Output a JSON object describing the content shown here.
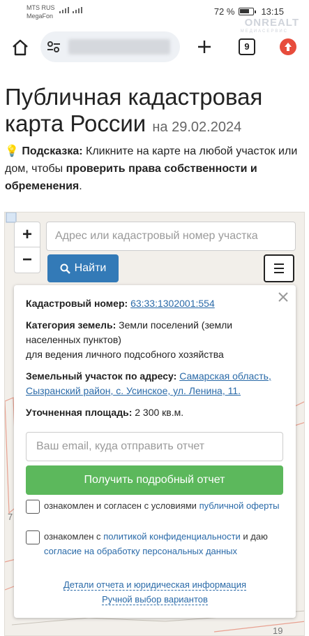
{
  "status_bar": {
    "carrier_1": "MTS RUS",
    "carrier_2": "MegaFon",
    "battery": "72 %",
    "time": "13:15",
    "watermark": "ONREALT",
    "watermark_sub": "МЕДИАСЕРВИС"
  },
  "browser": {
    "tabs_count": "9",
    "profile_color": "#e74c3c",
    "icons": [
      "home-icon",
      "tune-icon",
      "plus-icon",
      "tabs-icon",
      "profile-icon"
    ]
  },
  "page": {
    "title": "Публичная кадастровая карта России",
    "title_date": "на 29.02.2024",
    "hint_emoji": "💡",
    "hint_label": "Подсказка:",
    "hint_text_1": " Кликните на карте на любой участок или дом, чтобы ",
    "hint_bold": "проверить права собственности и обременения",
    "hint_text_2": "."
  },
  "map": {
    "zoom_in": "+",
    "zoom_out": "−",
    "search_placeholder": "Адрес или кадастровый номер участка",
    "find_label": "Найти",
    "label_7": "7",
    "label_19": "19"
  },
  "panel": {
    "cadastral_label": "Кадастровый номер:",
    "cadastral_value": "63:33:1302001:554",
    "category_label": "Категория земель:",
    "category_value": "Земли поселений (земли населенных пунктов)",
    "category_value_2": "для ведения личного подсобного хозяйства",
    "address_label": "Земельный участок по адресу:",
    "address_value": "Самарская область, Сызранский район, с. Усинское, ул. Ленина, 11.",
    "area_label": "Уточненная площадь:",
    "area_value": "2 300 кв.м.",
    "email_placeholder": "Ваш email, куда отправить отчет",
    "report_button": "Получить подробный отчет",
    "consent_1_text": "ознакомлен и согласен с условиями ",
    "consent_1_link": "публичной оферты",
    "consent_2_text_a": "ознакомлен с ",
    "consent_2_link_a": "политикой конфиденциальности",
    "consent_2_text_b": " и даю ",
    "consent_2_link_b": "согласие на обработку персональных данных",
    "details_link": "Детали отчета и юридическая информация",
    "manual_link": "Ручной выбор вариантов"
  },
  "colors": {
    "primary": "#337ab7",
    "success": "#5cb85c",
    "link": "#2a6aa8"
  }
}
